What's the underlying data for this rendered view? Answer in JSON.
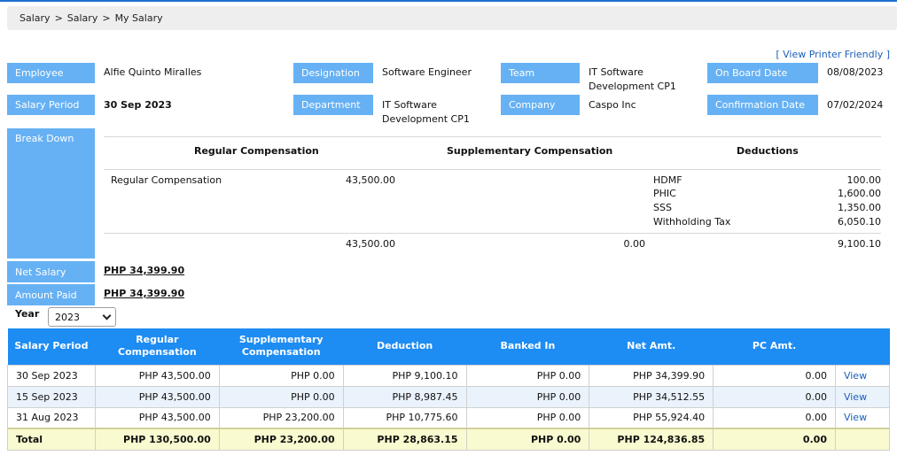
{
  "breadcrumb": [
    "Salary",
    "Salary",
    "My Salary"
  ],
  "breadcrumb_separator": ">",
  "printer_friendly": "[ View Printer Friendly ]",
  "info": {
    "employee_label": "Employee",
    "employee_value": "Alfie Quinto Miralles",
    "designation_label": "Designation",
    "designation_value": "Software Engineer",
    "team_label": "Team",
    "team_value_1": "IT Software",
    "team_value_2": "Development CP1",
    "onboard_label": "On Board Date",
    "onboard_value": "08/08/2023",
    "period_label": "Salary Period",
    "period_value": "30 Sep 2023",
    "department_label": "Department",
    "department_value_1": "IT Software",
    "department_value_2": "Development CP1",
    "company_label": "Company",
    "company_value": "Caspo Inc",
    "confirmation_label": "Confirmation Date",
    "confirmation_value": "07/02/2024"
  },
  "breakdown": {
    "label": "Break Down",
    "headers": [
      "Regular Compensation",
      "Supplementary Compensation",
      "Deductions"
    ],
    "regular": {
      "name": "Regular Compensation",
      "amount": "43,500.00"
    },
    "deductions": [
      {
        "name": "HDMF",
        "amount": "100.00"
      },
      {
        "name": "PHIC",
        "amount": "1,600.00"
      },
      {
        "name": "SSS",
        "amount": "1,350.00"
      },
      {
        "name": "Withholding Tax",
        "amount": "6,050.10"
      }
    ],
    "totals": {
      "regular": "43,500.00",
      "supplementary": "0.00",
      "deductions": "9,100.10"
    }
  },
  "net_salary_label": "Net Salary",
  "net_salary_value": "PHP 34,399.90",
  "amount_paid_label": "Amount Paid",
  "amount_paid_value": "PHP 34,399.90",
  "year_label": "Year",
  "year_value": "2023",
  "table": {
    "headers": [
      "Salary Period",
      "Regular Compensation",
      "Supplementary Compensation",
      "Deduction",
      "Banked In",
      "Net Amt.",
      "PC Amt.",
      ""
    ],
    "rows": [
      [
        "30 Sep 2023",
        "PHP 43,500.00",
        "PHP 0.00",
        "PHP 9,100.10",
        "PHP 0.00",
        "PHP 34,399.90",
        "0.00",
        "View"
      ],
      [
        "15 Sep 2023",
        "PHP 43,500.00",
        "PHP 0.00",
        "PHP 8,987.45",
        "PHP 0.00",
        "PHP 34,512.55",
        "0.00",
        "View"
      ],
      [
        "31 Aug 2023",
        "PHP 43,500.00",
        "PHP 23,200.00",
        "PHP 10,775.60",
        "PHP 0.00",
        "PHP 55,924.40",
        "0.00",
        "View"
      ]
    ],
    "total": [
      "Total",
      "PHP 130,500.00",
      "PHP 23,200.00",
      "PHP 28,863.15",
      "PHP 0.00",
      "PHP 124,836.85",
      "0.00",
      ""
    ]
  },
  "colors": {
    "label_bg": "#66b1f4",
    "table_header_bg": "#1d8cf3",
    "total_row_bg": "#fafad0",
    "link": "#1c5fb8"
  }
}
